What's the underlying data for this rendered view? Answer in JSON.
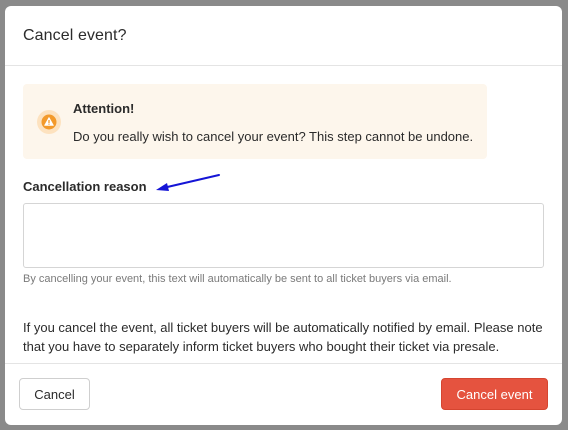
{
  "dialog": {
    "title": "Cancel event?"
  },
  "alert": {
    "icon": "warning-icon",
    "title": "Attention!",
    "message": "Do you really wish to cancel your event? This step cannot be undone."
  },
  "reason_field": {
    "label": "Cancellation reason",
    "value": "",
    "help_text": "By cancelling your event, this text will automatically be sent to all ticket buyers via email."
  },
  "info": {
    "text": "If you cancel the event, all ticket buyers will be automatically notified by email. Please note that you have to separately inform ticket buyers who bought their ticket via presale."
  },
  "footer": {
    "cancel_label": "Cancel",
    "confirm_label": "Cancel event"
  },
  "colors": {
    "alert_background": "#fdf6ec",
    "warning_accent": "#f39a2b",
    "danger_button": "#e5533f",
    "annotation_arrow": "#1515d6"
  }
}
